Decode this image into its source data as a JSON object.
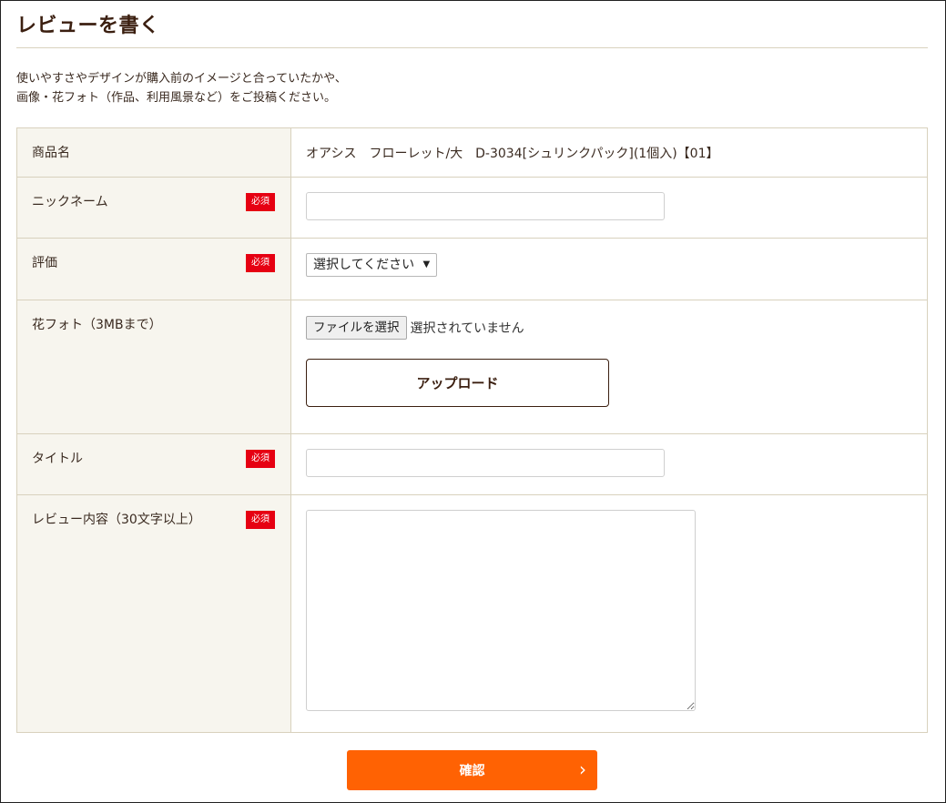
{
  "page": {
    "title": "レビューを書く",
    "intro_line1": "使いやすさやデザインが購入前のイメージと合っていたかや、",
    "intro_line2": "画像・花フォト（作品、利用風景など）をご投稿ください。"
  },
  "badges": {
    "required": "必須"
  },
  "form": {
    "product": {
      "label": "商品名",
      "value": "オアシス　フローレット/大　D-3034[シュリンクパック](1個入)【01】"
    },
    "nickname": {
      "label": "ニックネーム",
      "value": ""
    },
    "rating": {
      "label": "評価",
      "selected": "選択してください"
    },
    "photo": {
      "label": "花フォト（3MBまで）",
      "choose_file": "ファイルを選択",
      "file_status": "選択されていません",
      "upload": "アップロード"
    },
    "title": {
      "label": "タイトル",
      "value": ""
    },
    "review": {
      "label": "レビュー内容（30文字以上）",
      "value": ""
    }
  },
  "confirm": {
    "label": "確認",
    "chevron": "›"
  },
  "icons": {
    "select_arrow": "caret-down-icon",
    "confirm_arrow": "chevron-right-icon"
  },
  "colors": {
    "confirm": "#ff6203",
    "required_badge": "#e60012",
    "label_bg": "#f7f5ee"
  }
}
